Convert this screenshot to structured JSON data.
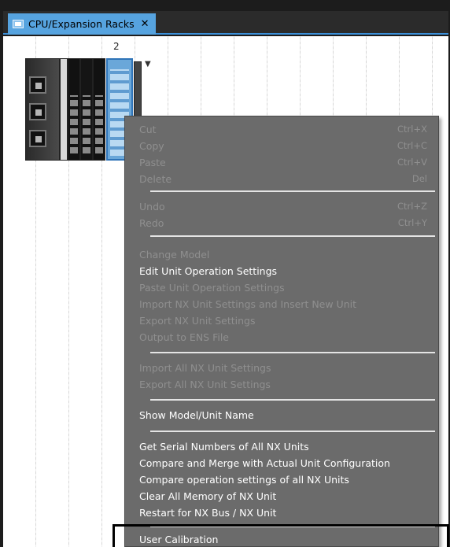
{
  "tab": {
    "title": "CPU/Expansion Racks",
    "close_glyph": "✕",
    "icon": "rack-tab-icon"
  },
  "canvas": {
    "slot_number": "2"
  },
  "colors": {
    "tab_bg": "#56a3df",
    "menu_bg": "#6b6b6b",
    "menu_text_enabled": "#ffffff",
    "menu_text_disabled": "#8f8f8f",
    "selected_unit": "#6aa7d9"
  },
  "context_menu": {
    "group_edit": [
      {
        "label": "Cut",
        "shortcut": "Ctrl+X",
        "enabled": false
      },
      {
        "label": "Copy",
        "shortcut": "Ctrl+C",
        "enabled": false
      },
      {
        "label": "Paste",
        "shortcut": "Ctrl+V",
        "enabled": false
      },
      {
        "label": "Delete",
        "shortcut": "Del",
        "enabled": false
      }
    ],
    "group_history": [
      {
        "label": "Undo",
        "shortcut": "Ctrl+Z",
        "enabled": false
      },
      {
        "label": "Redo",
        "shortcut": "Ctrl+Y",
        "enabled": false
      }
    ],
    "group_unit": [
      {
        "label": "Change Model",
        "enabled": false
      },
      {
        "label": "Edit Unit Operation Settings",
        "enabled": true
      },
      {
        "label": "Paste Unit Operation Settings",
        "enabled": false
      },
      {
        "label": "Import NX Unit Settings and Insert New Unit",
        "enabled": false
      },
      {
        "label": "Export NX Unit Settings",
        "enabled": false
      },
      {
        "label": "Output to ENS File",
        "enabled": false
      }
    ],
    "group_all": [
      {
        "label": "Import All NX Unit Settings",
        "enabled": false
      },
      {
        "label": "Export All NX Unit Settings",
        "enabled": false
      }
    ],
    "group_show": [
      {
        "label": "Show Model/Unit Name",
        "enabled": true
      }
    ],
    "group_online": [
      {
        "label": "Get Serial Numbers of All NX Units",
        "enabled": true
      },
      {
        "label": "Compare and Merge with Actual Unit Configuration",
        "enabled": true
      },
      {
        "label": "Compare operation settings of all NX Units",
        "enabled": true
      },
      {
        "label": "Clear All Memory of NX Unit",
        "enabled": true
      },
      {
        "label": "Restart for NX Bus / NX Unit",
        "enabled": true
      }
    ],
    "group_calibration": [
      {
        "label": "User Calibration",
        "enabled": true
      }
    ]
  }
}
